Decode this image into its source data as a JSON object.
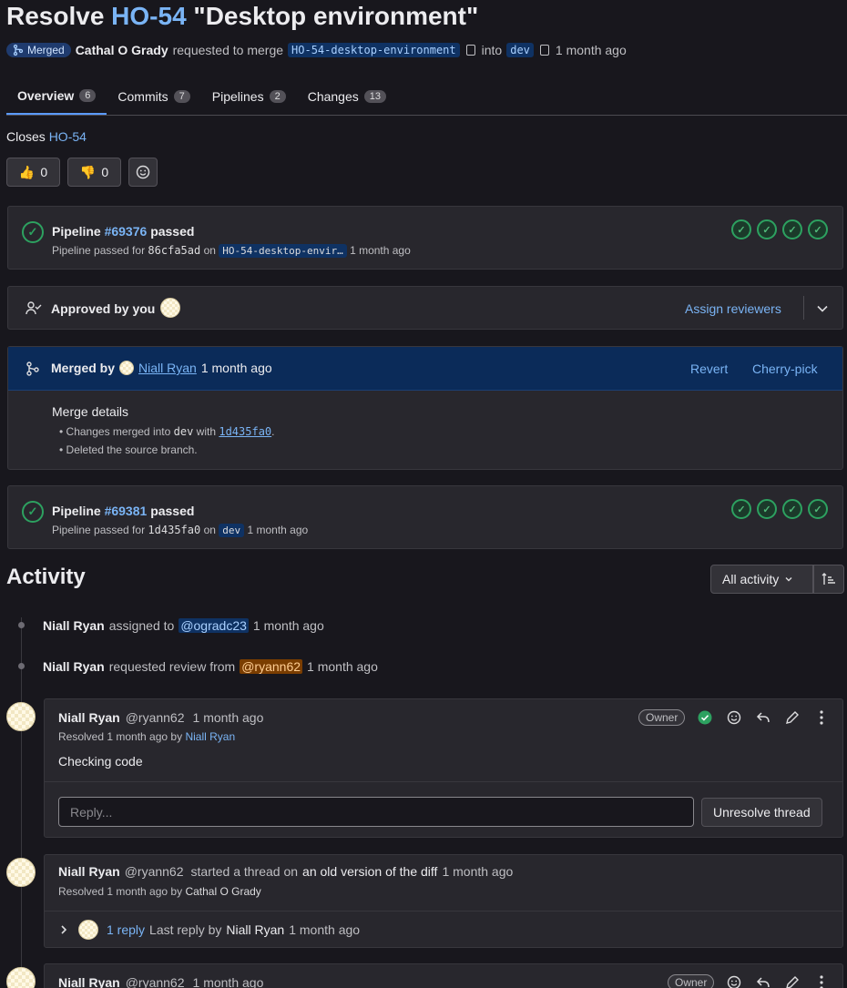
{
  "header": {
    "title_prefix": "Resolve ",
    "title_ref": "HO-54",
    "title_suffix": " \"Desktop environment\"",
    "status_badge": "Merged",
    "author": "Cathal O Grady",
    "requested_text": "requested to merge",
    "source_branch": "HO-54-desktop-environment",
    "into_text": "into",
    "target_branch": "dev",
    "time": "1 month ago"
  },
  "tabs": [
    {
      "label": "Overview",
      "count": "6"
    },
    {
      "label": "Commits",
      "count": "7"
    },
    {
      "label": "Pipelines",
      "count": "2"
    },
    {
      "label": "Changes",
      "count": "13"
    }
  ],
  "description": {
    "closes_text": "Closes",
    "closes_ref": "HO-54"
  },
  "reactions": {
    "thumbs_up": "👍",
    "thumbs_up_count": "0",
    "thumbs_down": "👎",
    "thumbs_down_count": "0"
  },
  "pipeline1": {
    "prefix": "Pipeline",
    "id": "#69376",
    "status": "passed",
    "sub_prefix": "Pipeline passed for",
    "commit": "86cfa5ad",
    "on_text": "on",
    "branch": "HO-54-desktop-envir…",
    "time": "1 month ago"
  },
  "approval": {
    "text": "Approved by you",
    "assign_label": "Assign reviewers"
  },
  "merge": {
    "prefix": "Merged by",
    "user": "Niall Ryan",
    "time": "1 month ago",
    "revert_label": "Revert",
    "cherry_label": "Cherry-pick",
    "details_title": "Merge details",
    "detail1_prefix": "Changes merged into",
    "detail1_branch": "dev",
    "detail1_with": "with",
    "detail1_commit": "1d435fa0",
    "detail1_suffix": ".",
    "detail2": "Deleted the source branch."
  },
  "pipeline2": {
    "prefix": "Pipeline",
    "id": "#69381",
    "status": "passed",
    "sub_prefix": "Pipeline passed for",
    "commit": "1d435fa0",
    "on_text": "on",
    "branch": "dev",
    "time": "1 month ago"
  },
  "activity": {
    "title": "Activity",
    "filter_label": "All activity",
    "events": [
      {
        "user": "Niall Ryan",
        "action": "assigned to",
        "mention": "@ogradc23",
        "time": "1 month ago"
      },
      {
        "user": "Niall Ryan",
        "action": "requested review from",
        "mention": "@ryann62",
        "time": "1 month ago"
      }
    ]
  },
  "note1": {
    "user": "Niall Ryan",
    "handle": "@ryann62",
    "time": "1 month ago",
    "role": "Owner",
    "resolved_prefix": "Resolved 1 month ago by",
    "resolved_by": "Niall Ryan",
    "body": "Checking code",
    "reply_placeholder": "Reply...",
    "unresolve_label": "Unresolve thread"
  },
  "note2": {
    "user": "Niall Ryan",
    "handle": "@ryann62",
    "started_text": "started a thread on",
    "diff_text": "an old version of the diff",
    "time": "1 month ago",
    "resolved_prefix": "Resolved 1 month ago by",
    "resolved_by": "Cathal O Grady",
    "reply_count": "1 reply",
    "last_reply": "Last reply by",
    "last_reply_user": "Niall Ryan",
    "last_reply_time": "1 month ago"
  },
  "note3": {
    "user": "Niall Ryan",
    "handle": "@ryann62",
    "time": "1 month ago",
    "role": "Owner"
  }
}
